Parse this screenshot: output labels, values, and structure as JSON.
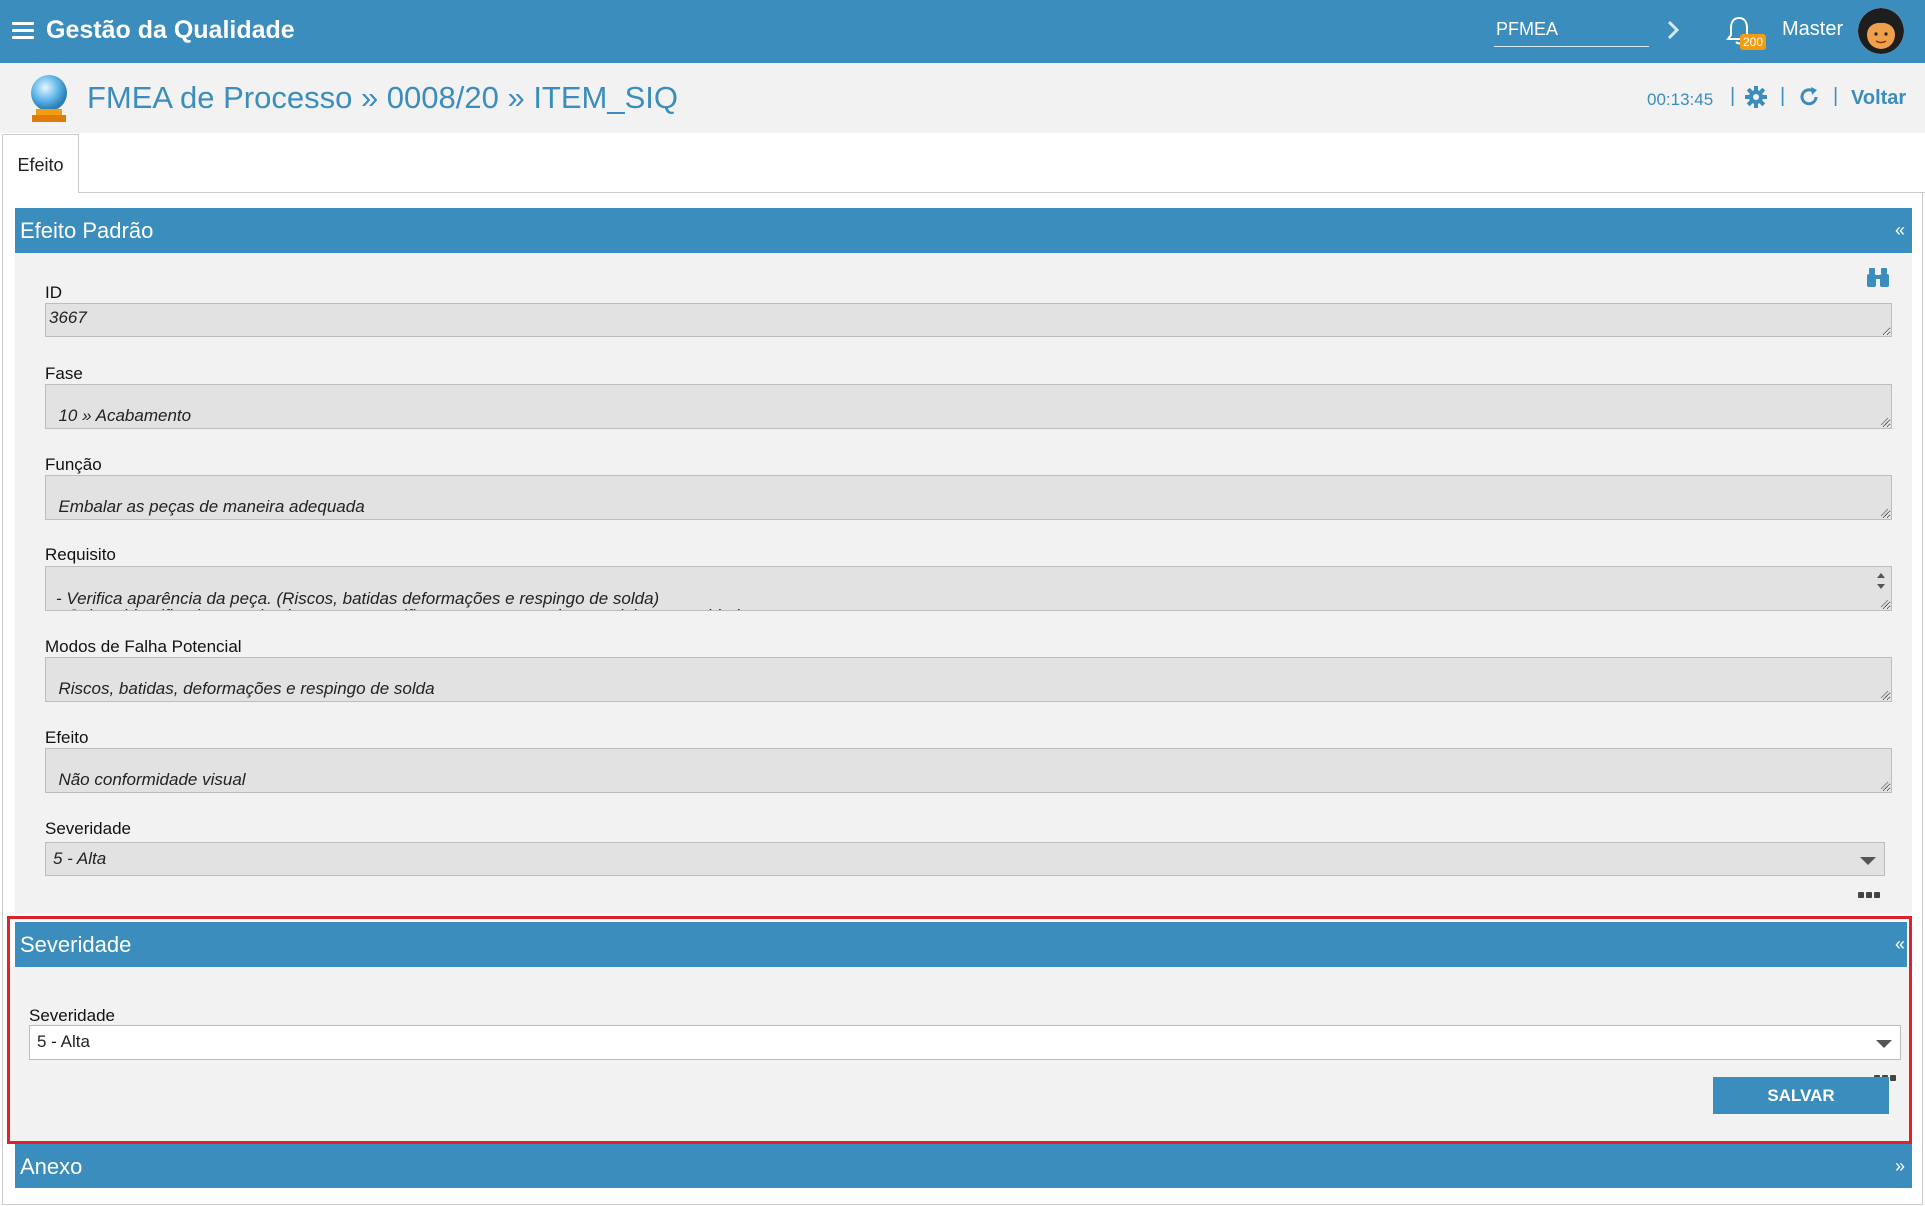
{
  "topbar": {
    "app_title": "Gestão da Qualidade",
    "module_value": "PFMEA",
    "notifications_count": "200",
    "user_name": "Master"
  },
  "header": {
    "title": "FMEA de Processo » 0008/20 » ITEM_SIQ",
    "timer": "00:13:45",
    "separator": "|",
    "back_label": "Voltar"
  },
  "tabs": [
    {
      "label": "Efeito"
    }
  ],
  "panel_efeito": {
    "title": "Efeito Padrão",
    "toggle": "«",
    "fields": {
      "id": {
        "label": "ID",
        "value": "3667"
      },
      "fase": {
        "label": "Fase",
        "value": "10 » Acabamento"
      },
      "funcao": {
        "label": "Função",
        "value": "Embalar as peças de maneira adequada"
      },
      "requisito": {
        "label": "Requisito",
        "value": "- Verifica aparência da peça. (Riscos, batidas deformações e respingo de solda)\n- Caixas identificadas com kanban  que especifica nome, part number, modelo e quantidade.\n- Não deve haver peças de modelos diferentes do identificado"
      },
      "modos_falha": {
        "label": "Modos de Falha Potencial",
        "value": "Riscos, batidas, deformações e respingo de solda"
      },
      "efeito": {
        "label": "Efeito",
        "value": "Não conformidade visual"
      },
      "severidade": {
        "label": "Severidade",
        "value": "5 - Alta"
      }
    }
  },
  "panel_severidade": {
    "title": "Severidade",
    "toggle": "«",
    "field_label": "Severidade",
    "selected": "5 - Alta",
    "save_label": "SALVAR"
  },
  "panel_anexo": {
    "title": "Anexo",
    "toggle": "»"
  },
  "colors": {
    "primary": "#3b8dbd",
    "highlight": "#e0202a",
    "badge": "#f39c12"
  }
}
